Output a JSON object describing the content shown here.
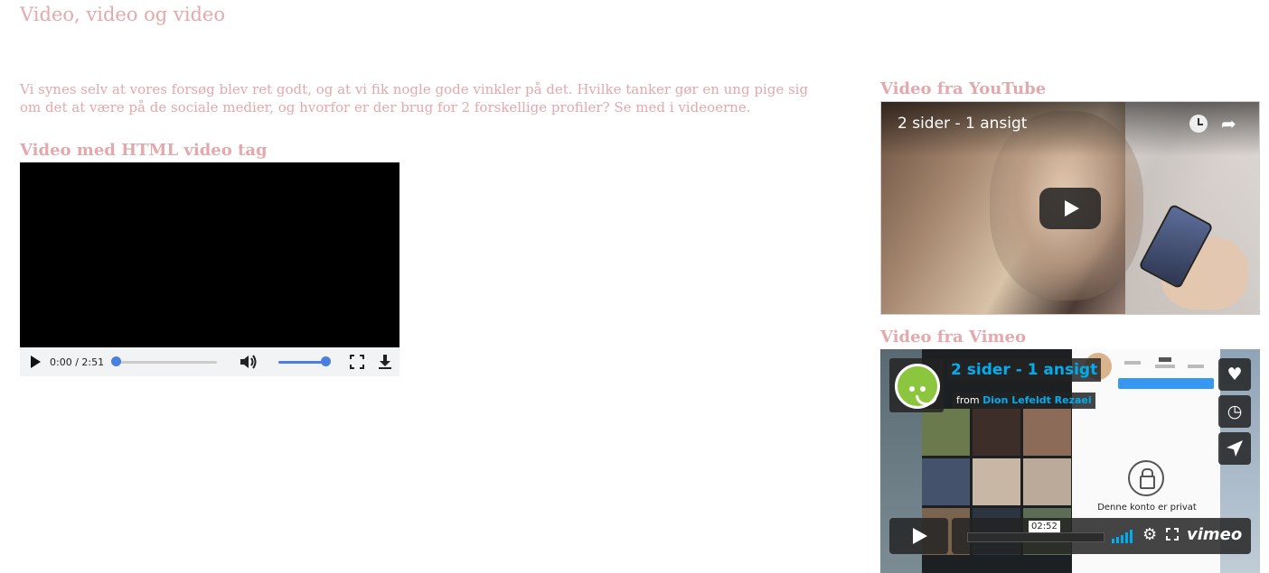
{
  "page": {
    "title": "Video, video og video",
    "intro": "Vi synes selv at vores forsøg blev ret godt, og at vi fik nogle gode vinkler på det. Hvilke tanker gør en ung pige sig om det at være på de sociale medier, og hvorfor er der brug for 2 forskellige profiler? Se med i videoerne."
  },
  "headings": {
    "html_video": "Video med HTML video tag",
    "youtube": "Video fra YouTube",
    "vimeo": "Video fra Vimeo"
  },
  "html_video": {
    "time": "0:00 / 2:51",
    "progress": 0.0,
    "volume": 1.0,
    "icons": [
      "play-icon",
      "volume-icon",
      "fullscreen-icon",
      "download-icon"
    ]
  },
  "youtube": {
    "title": "2 sider - 1 ansigt",
    "icons": [
      "watch-later-icon",
      "share-icon",
      "play-icon"
    ]
  },
  "vimeo": {
    "title": "2 sider - 1 ansigt",
    "from_label": "from",
    "author": "Dion Lefeldt Rezaei",
    "time": "02:52",
    "brand": "vimeo",
    "private_notice": "Denne konto er privat",
    "icons": [
      "like-icon",
      "watch-later-icon",
      "share-icon",
      "play-icon",
      "volume-icon",
      "settings-icon",
      "fullscreen-icon"
    ]
  },
  "colors": {
    "heading_pink": "#e3a9ad",
    "vimeo_blue": "#00adef",
    "progress_blue": "#4a7fe0"
  }
}
